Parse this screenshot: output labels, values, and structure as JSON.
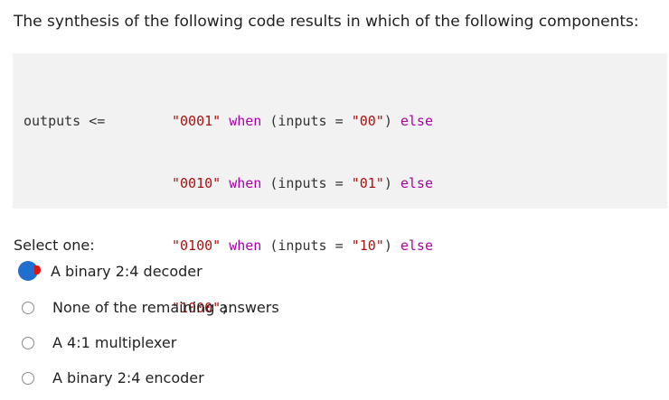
{
  "question": "The synthesis of the following code results in which of the following components:",
  "code": {
    "line1": {
      "a": "outputs <=",
      "s1": "\"0001\"",
      "k1": "when",
      "p1": "(inputs = ",
      "s2": "\"00\"",
      "p2": ")",
      "k2": "else"
    },
    "line2": {
      "s1": "\"0010\"",
      "k1": "when",
      "p1": "(inputs = ",
      "s2": "\"01\"",
      "p2": ")",
      "k2": "else"
    },
    "line3": {
      "s1": "\"0100\"",
      "k1": "when",
      "p1": "(inputs = ",
      "s2": "\"10\"",
      "p2": ")",
      "k2": "else"
    },
    "line4": {
      "s1": "\"1000\"",
      "p1": ";"
    }
  },
  "select_label": "Select one:",
  "options": [
    {
      "label": "A binary 2:4 decoder",
      "selected": true
    },
    {
      "label": "None of the remaining answers",
      "selected": false
    },
    {
      "label": "A 4:1 multiplexer",
      "selected": false
    },
    {
      "label": "A binary 2:4 encoder",
      "selected": false
    }
  ],
  "colors": {
    "selected_radio": "#1f6fd1",
    "selected_radio_tip": "#e01414",
    "code_background": "#f2f2f2"
  }
}
